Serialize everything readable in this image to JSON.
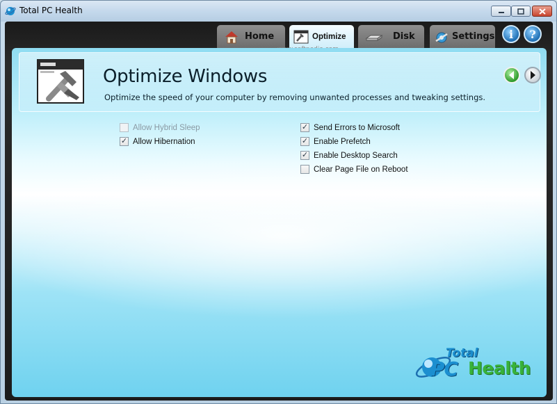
{
  "window": {
    "title": "Total PC Health",
    "controls": {
      "minimize": "minimize-icon",
      "maximize": "maximize-icon",
      "close": "close-icon"
    }
  },
  "tabs": [
    {
      "label": "Home",
      "icon": "house-icon",
      "active": false
    },
    {
      "label": "Optimize",
      "icon": "optimize-icon",
      "active": true
    },
    {
      "label": "Disk",
      "icon": "disk-icon",
      "active": false
    },
    {
      "label": "Settings",
      "icon": "settings-icon",
      "active": false
    }
  ],
  "top_buttons": {
    "info": "i",
    "help": "?"
  },
  "watermark": "www.softpedia.com",
  "page": {
    "title": "Optimize Windows",
    "description": "Optimize the speed of your computer by removing unwanted processes and tweaking settings."
  },
  "options_left": [
    {
      "label": "Allow Hybrid Sleep",
      "checked": false,
      "enabled": false
    },
    {
      "label": "Allow Hibernation",
      "checked": true,
      "enabled": true
    }
  ],
  "options_right": [
    {
      "label": "Send Errors to Microsoft",
      "checked": true,
      "enabled": true
    },
    {
      "label": "Enable Prefetch",
      "checked": true,
      "enabled": true
    },
    {
      "label": "Enable Desktop Search",
      "checked": true,
      "enabled": true
    },
    {
      "label": "Clear Page File on Reboot",
      "checked": false,
      "enabled": true
    }
  ],
  "logo": {
    "line1": "Total",
    "line2a": "PC",
    "line2b": "Health"
  },
  "colors": {
    "accent": "#1c8fd0",
    "health_green": "#38b23a",
    "panel_blue": "#6fd2ef"
  }
}
